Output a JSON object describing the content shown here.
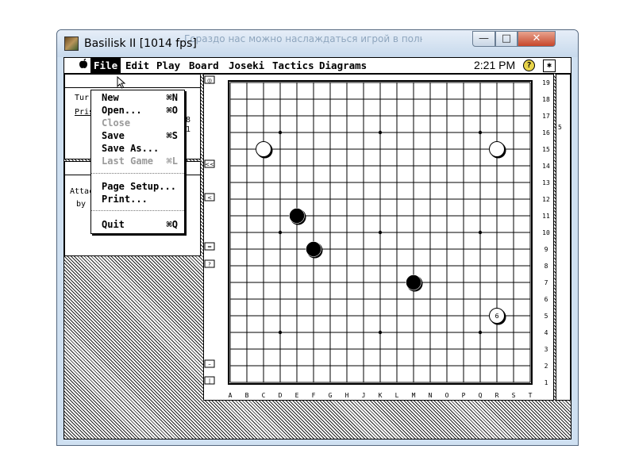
{
  "window": {
    "title": "Basilisk II [1014 fps]",
    "ghost_text": "Гораздо нас можно наслаждаться игрой в полную"
  },
  "caption_buttons": {
    "minimize": "—",
    "maximize": "□",
    "close": "✕"
  },
  "menubar": {
    "apple": "",
    "items": [
      "File",
      "Edit",
      "Play",
      "Board",
      "Joseki",
      "Tactics",
      "Diagrams"
    ],
    "clock": "2:21 PM",
    "help_icon": "?",
    "app_icon": "✱"
  },
  "file_menu": {
    "items": [
      {
        "label": "New",
        "shortcut": "⌘N",
        "enabled": true
      },
      {
        "label": "Open...",
        "shortcut": "⌘O",
        "enabled": true
      },
      {
        "label": "Close",
        "shortcut": "",
        "enabled": false
      },
      {
        "label": "Save",
        "shortcut": "⌘S",
        "enabled": true
      },
      {
        "label": "Save As...",
        "shortcut": "",
        "enabled": true
      },
      {
        "label": "Last Game",
        "shortcut": "⌘L",
        "enabled": false
      },
      {
        "label": "Page Setup...",
        "shortcut": "",
        "enabled": true
      },
      {
        "label": "Print...",
        "shortcut": "",
        "enabled": true
      },
      {
        "label": "Quit",
        "shortcut": "⌘Q",
        "enabled": true
      }
    ]
  },
  "info_window": {
    "line1": "Tur",
    "line2": "Pris",
    "frag1": "8",
    "frag2": "1"
  },
  "attack_window": {
    "line1": "Attac",
    "line2": "by u"
  },
  "board": {
    "size": 19,
    "col_labels": [
      "A",
      "B",
      "C",
      "D",
      "E",
      "F",
      "G",
      "H",
      "J",
      "K",
      "L",
      "M",
      "N",
      "O",
      "P",
      "Q",
      "R",
      "S",
      "T"
    ],
    "row_labels": [
      "19",
      "18",
      "17",
      "16",
      "15",
      "14",
      "13",
      "12",
      "11",
      "10",
      "9",
      "8",
      "7",
      "6",
      "5",
      "4",
      "3",
      "2",
      "1"
    ],
    "hoshi": [
      [
        4,
        4
      ],
      [
        10,
        4
      ],
      [
        16,
        4
      ],
      [
        4,
        10
      ],
      [
        10,
        10
      ],
      [
        16,
        10
      ],
      [
        4,
        16
      ],
      [
        10,
        16
      ],
      [
        16,
        16
      ]
    ],
    "stones": [
      {
        "col": 3,
        "row": 15,
        "color": "white",
        "label": ""
      },
      {
        "col": 17,
        "row": 15,
        "color": "white",
        "label": ""
      },
      {
        "col": 5,
        "row": 11,
        "color": "black",
        "label": ""
      },
      {
        "col": 6,
        "row": 9,
        "color": "black",
        "label": ""
      },
      {
        "col": 12,
        "row": 7,
        "color": "black",
        "label": ""
      },
      {
        "col": 17,
        "row": 5,
        "color": "white",
        "label": "6"
      }
    ],
    "left_buttons": [
      "◎",
      "<<",
      "<",
      "=",
      "?",
      "–",
      "|"
    ],
    "right_fragment": "5"
  },
  "colors": {
    "titlebar": "#c7d9ec",
    "close_button": "#c7462a",
    "black_stone": "#000000",
    "white_stone": "#ffffff"
  }
}
